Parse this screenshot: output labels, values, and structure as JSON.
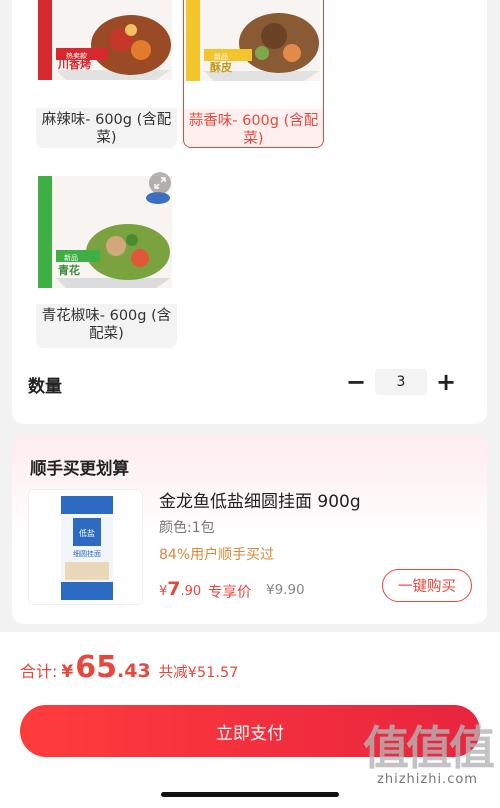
{
  "variants": [
    {
      "label": "麻辣味- 600g (含配菜)",
      "pack_text": "川香烤",
      "pack_badge": "热卖款",
      "selected": false
    },
    {
      "label": "蒜香味- 600g (含配菜)",
      "pack_text": "酥皮",
      "pack_badge": "新品",
      "selected": true
    },
    {
      "label": "青花椒味- 600g (含配菜)",
      "pack_text": "青花",
      "pack_badge": "新品",
      "selected": false
    }
  ],
  "quantity": {
    "label": "数量",
    "minus": "−",
    "value": "3",
    "plus": "+"
  },
  "recommend": {
    "title": "顺手买更划算",
    "product_name": "金龙鱼低盐细圆挂面 900g",
    "spec": "颜色:1包",
    "hint": "84%用户顺手买过",
    "currency": "¥",
    "price_int": "7",
    "price_dec": ".90",
    "price_tag": "专享价",
    "original_price": "¥9.90",
    "buy_label": "一键购买",
    "pack_text": "细圆挂面",
    "pack_brand": "低盐"
  },
  "footer": {
    "total_label": "合计:",
    "currency": "¥",
    "total_int": "65",
    "total_dec": ".43",
    "save_text": "共减¥51.57",
    "pay_label": "立即支付"
  },
  "watermark": {
    "big": "值值值",
    "small": "zhizhizhi.com"
  },
  "colors": {
    "accent": "#e8473d",
    "hint": "#d8893b"
  }
}
